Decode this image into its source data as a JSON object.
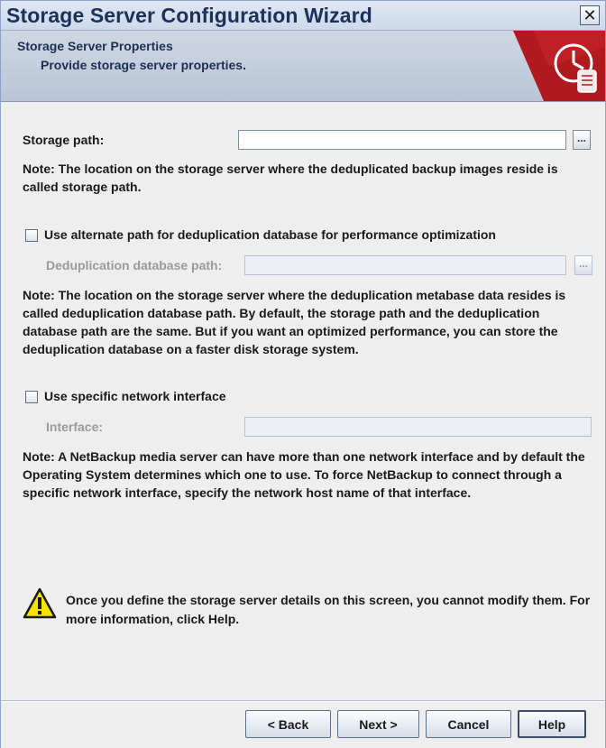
{
  "window": {
    "title": "Storage Server Configuration Wizard",
    "close_glyph": "✕"
  },
  "banner": {
    "title": "Storage Server Properties",
    "subtitle": "Provide storage server properties.",
    "icon": "clock-scroll-icon",
    "accent_color": "#b0191e"
  },
  "storage_path": {
    "label": "Storage path:",
    "value": "",
    "browse_label": "..."
  },
  "notes": {
    "storage_path": "Note: The location on the storage server where the deduplicated backup images reside is called storage path.",
    "dedup_path": "Note: The location on the storage server where the deduplication metabase data resides is called deduplication database path. By default, the storage path and the deduplication database path are the same. But if you want an optimized performance, you can store the deduplication database on a faster disk storage system.",
    "network": "Note: A NetBackup media server can have more than one network interface and by default the Operating System determines which one to use. To force NetBackup to connect through a specific network interface, specify the network host name of that interface."
  },
  "alternate_path": {
    "checkbox_label": "Use alternate path for deduplication database for performance optimization",
    "checked": false,
    "field_label": "Deduplication database path:",
    "value": "",
    "browse_label": "..."
  },
  "network_interface": {
    "checkbox_label": "Use specific network interface",
    "checked": false,
    "field_label": "Interface:",
    "value": ""
  },
  "warning": {
    "icon": "warning-icon",
    "text": "Once you define the storage server details on this screen, you cannot modify them. For more information, click Help."
  },
  "buttons": {
    "back": "< Back",
    "next": "Next >",
    "cancel": "Cancel",
    "help": "Help"
  }
}
